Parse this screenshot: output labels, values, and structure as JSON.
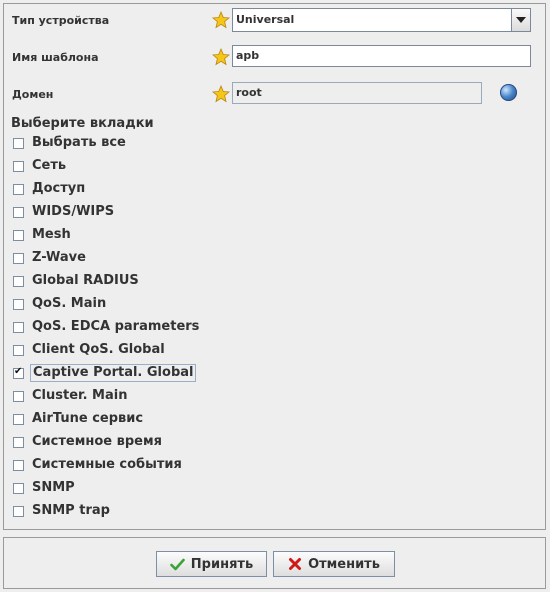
{
  "form": {
    "device_type": {
      "label": "Тип устройства",
      "value": "Universal"
    },
    "template_name": {
      "label": "Имя шаблона",
      "value": "apb"
    },
    "domain": {
      "label": "Домен",
      "value": "root"
    }
  },
  "tabs_section": {
    "title": "Выберите вкладки",
    "items": [
      {
        "label": "Выбрать все",
        "checked": false
      },
      {
        "label": "Сеть",
        "checked": false
      },
      {
        "label": "Доступ",
        "checked": false
      },
      {
        "label": "WIDS/WIPS",
        "checked": false
      },
      {
        "label": "Mesh",
        "checked": false
      },
      {
        "label": "Z-Wave",
        "checked": false
      },
      {
        "label": "Global RADIUS",
        "checked": false
      },
      {
        "label": "QoS. Main",
        "checked": false
      },
      {
        "label": "QoS. EDCA parameters",
        "checked": false
      },
      {
        "label": "Client QoS. Global",
        "checked": false
      },
      {
        "label": "Captive Portal. Global",
        "checked": true
      },
      {
        "label": "Cluster. Main",
        "checked": false
      },
      {
        "label": "AirTune сервис",
        "checked": false
      },
      {
        "label": "Системное время",
        "checked": false
      },
      {
        "label": "Системные события",
        "checked": false
      },
      {
        "label": "SNMP",
        "checked": false
      },
      {
        "label": "SNMP trap",
        "checked": false
      }
    ]
  },
  "buttons": {
    "accept": {
      "label": "Принять",
      "icon": "check-icon"
    },
    "cancel": {
      "label": "Отменить",
      "icon": "x-icon"
    }
  },
  "colors": {
    "required_star": "#f5c518",
    "accept_icon": "#3aa335",
    "cancel_icon": "#d01818"
  }
}
